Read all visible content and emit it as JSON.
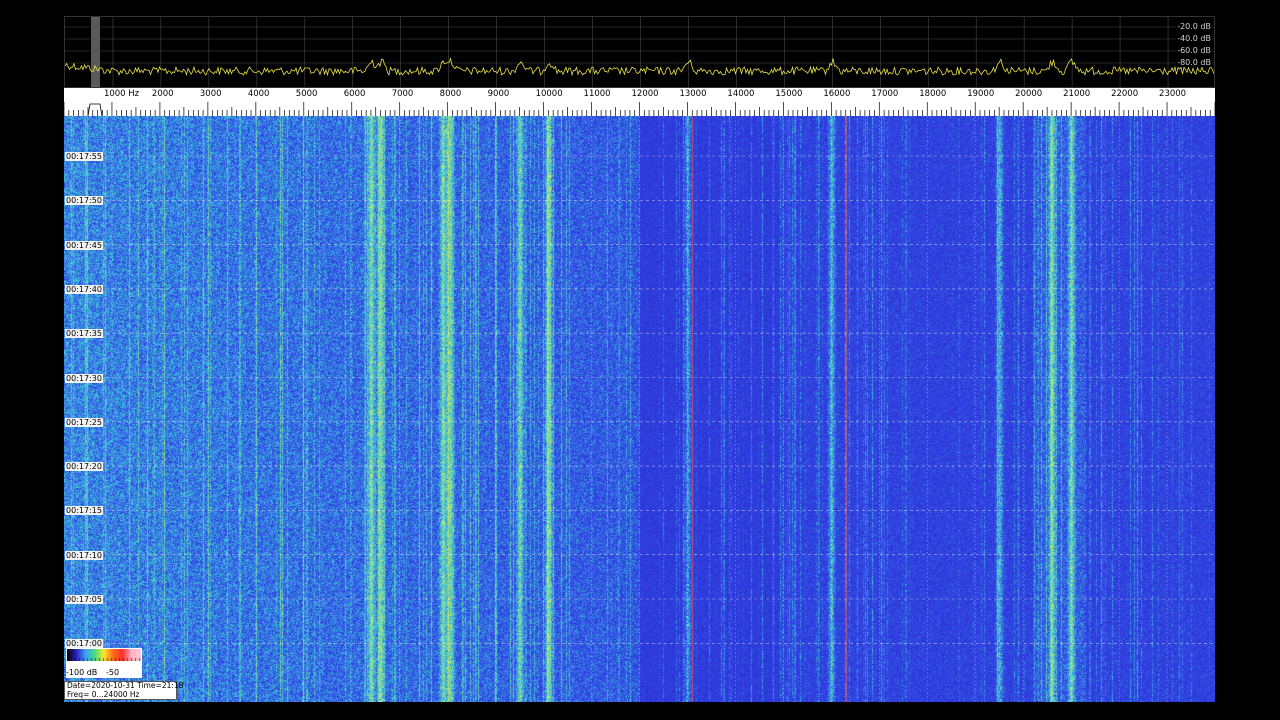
{
  "spectrum": {
    "db_labels": [
      "-20.0 dB",
      "-40.0 dB",
      "-60.0 dB",
      "-80.0 dB"
    ],
    "trace_color": "#e8e04a",
    "grid_color": "#4a4a4a"
  },
  "ruler": {
    "max_hz": 24000,
    "ticks": [
      {
        "hz": 1000,
        "label": "1000 Hz"
      },
      {
        "hz": 2000,
        "label": "2000"
      },
      {
        "hz": 3000,
        "label": "3000"
      },
      {
        "hz": 4000,
        "label": "4000"
      },
      {
        "hz": 5000,
        "label": "5000"
      },
      {
        "hz": 6000,
        "label": "6000"
      },
      {
        "hz": 7000,
        "label": "7000"
      },
      {
        "hz": 8000,
        "label": "8000"
      },
      {
        "hz": 9000,
        "label": "9000"
      },
      {
        "hz": 10000,
        "label": "10000"
      },
      {
        "hz": 11000,
        "label": "11000"
      },
      {
        "hz": 12000,
        "label": "12000"
      },
      {
        "hz": 13000,
        "label": "13000"
      },
      {
        "hz": 14000,
        "label": "14000"
      },
      {
        "hz": 15000,
        "label": "15000"
      },
      {
        "hz": 16000,
        "label": "16000"
      },
      {
        "hz": 17000,
        "label": "17000"
      },
      {
        "hz": 18000,
        "label": "18000"
      },
      {
        "hz": 19000,
        "label": "19000"
      },
      {
        "hz": 20000,
        "label": "20000"
      },
      {
        "hz": 21000,
        "label": "21000"
      },
      {
        "hz": 22000,
        "label": "22000"
      },
      {
        "hz": 23000,
        "label": "23000"
      }
    ]
  },
  "waterfall": {
    "time_labels": [
      "00:17:55",
      "00:17:50",
      "00:17:45",
      "00:17:40",
      "00:17:35",
      "00:17:30",
      "00:17:25",
      "00:17:20",
      "00:17:15",
      "00:17:10",
      "00:17:05",
      "00:17:00"
    ],
    "bright_bands_hz": [
      6400,
      6600,
      7900,
      8050,
      9500,
      10100,
      13000,
      16000,
      19500,
      20600,
      21000
    ],
    "red_lines_hz": [
      13100,
      16300
    ]
  },
  "colorbar": {
    "label_min": "-100 dB",
    "label_mid": "-50",
    "colors": [
      "#000000",
      "#2b1fbf",
      "#3fa0ff",
      "#43e07a",
      "#ffe630",
      "#ff6b1a",
      "#ff2f2f",
      "#ffb6c8",
      "#ffc6d4"
    ]
  },
  "info": {
    "line1": "Date=2020-10-31 Time=21:18",
    "line2": "Freq= 0...24000 Hz"
  }
}
